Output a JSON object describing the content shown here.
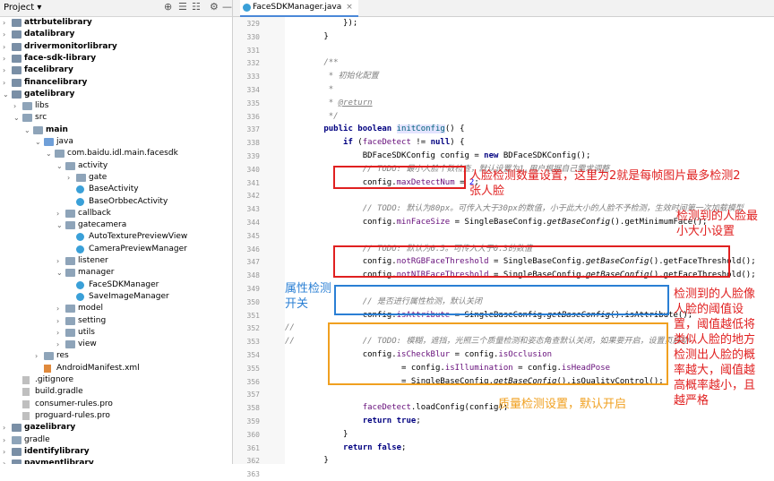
{
  "project": {
    "title": "Project",
    "title_arrow": "▾",
    "toolbar": [
      "⊕",
      "☰",
      "☷",
      "⚙",
      "—"
    ],
    "tree": [
      {
        "arrow": "›",
        "icon": "mod",
        "label": "attrbutelibrary",
        "bold": true,
        "indent": 0
      },
      {
        "arrow": "›",
        "icon": "mod",
        "label": "datalibrary",
        "bold": true,
        "indent": 0
      },
      {
        "arrow": "›",
        "icon": "mod",
        "label": "drivermonitorlibrary",
        "bold": true,
        "indent": 0
      },
      {
        "arrow": "›",
        "icon": "mod",
        "label": "face-sdk-library",
        "bold": true,
        "indent": 0
      },
      {
        "arrow": "›",
        "icon": "mod",
        "label": "facelibrary",
        "bold": true,
        "indent": 0
      },
      {
        "arrow": "›",
        "icon": "mod",
        "label": "financelibrary",
        "bold": true,
        "indent": 0
      },
      {
        "arrow": "⌄",
        "icon": "mod",
        "label": "gatelibrary",
        "bold": true,
        "indent": 0
      },
      {
        "arrow": "›",
        "icon": "folder",
        "label": "libs",
        "bold": false,
        "indent": 1
      },
      {
        "arrow": "⌄",
        "icon": "folder",
        "label": "src",
        "bold": false,
        "indent": 1
      },
      {
        "arrow": "⌄",
        "icon": "folder",
        "label": "main",
        "bold": true,
        "indent": 2
      },
      {
        "arrow": "⌄",
        "icon": "src",
        "label": "java",
        "bold": false,
        "indent": 3
      },
      {
        "arrow": "⌄",
        "icon": "folder",
        "label": "com.baidu.idl.main.facesdk",
        "bold": false,
        "indent": 4
      },
      {
        "arrow": "⌄",
        "icon": "folder",
        "label": "activity",
        "bold": false,
        "indent": 5
      },
      {
        "arrow": "›",
        "icon": "folder",
        "label": "gate",
        "bold": false,
        "indent": 6
      },
      {
        "arrow": "",
        "icon": "cls",
        "label": "BaseActivity",
        "bold": false,
        "indent": 6
      },
      {
        "arrow": "",
        "icon": "cls",
        "label": "BaseOrbbecActivity",
        "bold": false,
        "indent": 6
      },
      {
        "arrow": "›",
        "icon": "folder",
        "label": "callback",
        "bold": false,
        "indent": 5
      },
      {
        "arrow": "⌄",
        "icon": "folder",
        "label": "gatecamera",
        "bold": false,
        "indent": 5
      },
      {
        "arrow": "",
        "icon": "cls",
        "label": "AutoTexturePreviewView",
        "bold": false,
        "indent": 6
      },
      {
        "arrow": "",
        "icon": "cls",
        "label": "CameraPreviewManager",
        "bold": false,
        "indent": 6
      },
      {
        "arrow": "›",
        "icon": "folder",
        "label": "listener",
        "bold": false,
        "indent": 5
      },
      {
        "arrow": "⌄",
        "icon": "folder",
        "label": "manager",
        "bold": false,
        "indent": 5
      },
      {
        "arrow": "",
        "icon": "cls",
        "label": "FaceSDKManager",
        "bold": false,
        "indent": 6
      },
      {
        "arrow": "",
        "icon": "cls",
        "label": "SaveImageManager",
        "bold": false,
        "indent": 6
      },
      {
        "arrow": "›",
        "icon": "folder",
        "label": "model",
        "bold": false,
        "indent": 5
      },
      {
        "arrow": "›",
        "icon": "folder",
        "label": "setting",
        "bold": false,
        "indent": 5
      },
      {
        "arrow": "›",
        "icon": "folder",
        "label": "utils",
        "bold": false,
        "indent": 5
      },
      {
        "arrow": "›",
        "icon": "folder",
        "label": "view",
        "bold": false,
        "indent": 5
      },
      {
        "arrow": "›",
        "icon": "folder",
        "label": "res",
        "bold": false,
        "indent": 3
      },
      {
        "arrow": "",
        "icon": "xml",
        "label": "AndroidManifest.xml",
        "bold": false,
        "indent": 3
      },
      {
        "arrow": "",
        "icon": "file",
        "label": ".gitignore",
        "bold": false,
        "indent": 1
      },
      {
        "arrow": "",
        "icon": "file",
        "label": "build.gradle",
        "bold": false,
        "indent": 1
      },
      {
        "arrow": "",
        "icon": "file",
        "label": "consumer-rules.pro",
        "bold": false,
        "indent": 1
      },
      {
        "arrow": "",
        "icon": "file",
        "label": "proguard-rules.pro",
        "bold": false,
        "indent": 1
      },
      {
        "arrow": "›",
        "icon": "mod",
        "label": "gazelibrary",
        "bold": true,
        "indent": 0
      },
      {
        "arrow": "›",
        "icon": "folder",
        "label": "gradle",
        "bold": false,
        "indent": 0
      },
      {
        "arrow": "›",
        "icon": "mod",
        "label": "identifylibrary",
        "bold": true,
        "indent": 0
      },
      {
        "arrow": "›",
        "icon": "mod",
        "label": "paymentlibrary",
        "bold": true,
        "indent": 0
      }
    ]
  },
  "editor": {
    "tab_label": "FaceSDKManager.java",
    "tab_close": "×",
    "lines": [
      {
        "n": "329",
        "c": [
          [
            "",
            "            });"
          ]
        ]
      },
      {
        "n": "330",
        "c": [
          [
            "",
            "        }"
          ]
        ]
      },
      {
        "n": "331",
        "c": [
          [
            "",
            ""
          ]
        ]
      },
      {
        "n": "332",
        "c": [
          [
            "cm",
            "        /**"
          ]
        ]
      },
      {
        "n": "333",
        "c": [
          [
            "cm",
            "         * 初始化配置"
          ]
        ]
      },
      {
        "n": "334",
        "c": [
          [
            "cm",
            "         *"
          ]
        ]
      },
      {
        "n": "335",
        "c": [
          [
            "cm",
            "         * "
          ],
          [
            "tag",
            "@return"
          ]
        ]
      },
      {
        "n": "336",
        "c": [
          [
            "cm",
            "         */"
          ]
        ]
      },
      {
        "n": "337",
        "c": [
          [
            "kw",
            "        public boolean "
          ],
          [
            "fn",
            "initConfig"
          ],
          [
            "",
            "() {"
          ]
        ]
      },
      {
        "n": "338",
        "c": [
          [
            "kw",
            "            if "
          ],
          [
            "",
            "("
          ],
          [
            "fld",
            "faceDetect"
          ],
          [
            "",
            " != "
          ],
          [
            "kw",
            "null"
          ],
          [
            "",
            ") {"
          ]
        ]
      },
      {
        "n": "339",
        "c": [
          [
            "",
            "                BDFaceSDKConfig config = "
          ],
          [
            "kw",
            "new "
          ],
          [
            "",
            "BDFaceSDKConfig();"
          ]
        ]
      },
      {
        "n": "340",
        "c": [
          [
            "cm",
            "                // TODO: 最小人脸个数检查，默认设置为1,用户根据自己需求调整"
          ]
        ]
      },
      {
        "n": "341",
        "c": [
          [
            "",
            "                config."
          ],
          [
            "fld",
            "maxDetectNum"
          ],
          [
            "",
            " = "
          ],
          [
            "num",
            "2"
          ],
          [
            "",
            ";"
          ]
        ]
      },
      {
        "n": "342",
        "c": [
          [
            "",
            ""
          ]
        ]
      },
      {
        "n": "343",
        "c": [
          [
            "cm",
            "                // TODO: 默认为80px。可传入大于30px的数值，小于此大小的人脸不予检测，生效时间第一次加载模型"
          ]
        ]
      },
      {
        "n": "344",
        "c": [
          [
            "",
            "                config."
          ],
          [
            "fld",
            "minFaceSize"
          ],
          [
            "",
            " = SingleBaseConfig."
          ],
          [
            "mi",
            "getBaseConfig"
          ],
          [
            "",
            "().getMinimumFace();"
          ]
        ]
      },
      {
        "n": "345",
        "c": [
          [
            "",
            ""
          ]
        ]
      },
      {
        "n": "346",
        "c": [
          [
            "cm",
            "                // TODO: 默认为0.5。可传入大于0.3的数值"
          ]
        ]
      },
      {
        "n": "347",
        "c": [
          [
            "",
            "                config."
          ],
          [
            "fld",
            "notRGBFaceThreshold"
          ],
          [
            "",
            " = SingleBaseConfig."
          ],
          [
            "mi",
            "getBaseConfig"
          ],
          [
            "",
            "().getFaceThreshold();"
          ]
        ]
      },
      {
        "n": "348",
        "c": [
          [
            "",
            "                config."
          ],
          [
            "fld",
            "notNIRFaceThreshold"
          ],
          [
            "",
            " = SingleBaseConfig."
          ],
          [
            "mi",
            "getBaseConfig"
          ],
          [
            "",
            "().getFaceThreshold();"
          ]
        ]
      },
      {
        "n": "349",
        "c": [
          [
            "",
            ""
          ]
        ]
      },
      {
        "n": "350",
        "c": [
          [
            "cm",
            "                // 是否进行属性检测，默认关闭"
          ]
        ]
      },
      {
        "n": "351",
        "c": [
          [
            "",
            "                config."
          ],
          [
            "fld",
            "isAttribute"
          ],
          [
            "",
            " = SingleBaseConfig."
          ],
          [
            "mi",
            "getBaseConfig"
          ],
          [
            "",
            "().isAttribute();"
          ]
        ]
      },
      {
        "n": "352",
        "c": [
          [
            "cm",
            "//"
          ]
        ]
      },
      {
        "n": "353",
        "c": [
          [
            "cm",
            "//              // TODO: 模糊，遮挡，光照三个质量检测和姿态角查默认关闭，如果要开启，设置页启动"
          ]
        ]
      },
      {
        "n": "354",
        "c": [
          [
            "",
            "                config."
          ],
          [
            "fld",
            "isCheckBlur"
          ],
          [
            "",
            " = config."
          ],
          [
            "fld",
            "isOcclusion"
          ]
        ]
      },
      {
        "n": "355",
        "c": [
          [
            "",
            "                        = config."
          ],
          [
            "fld",
            "isIllumination"
          ],
          [
            "",
            " = config."
          ],
          [
            "fld",
            "isHeadPose"
          ]
        ]
      },
      {
        "n": "356",
        "c": [
          [
            "",
            "                        = SingleBaseConfig."
          ],
          [
            "mi",
            "getBaseConfig"
          ],
          [
            "",
            "().isQualityControl();"
          ]
        ]
      },
      {
        "n": "357",
        "c": [
          [
            "",
            ""
          ]
        ]
      },
      {
        "n": "358",
        "c": [
          [
            "",
            "                "
          ],
          [
            "fld",
            "faceDetect"
          ],
          [
            "",
            ".loadConfig(config);"
          ]
        ]
      },
      {
        "n": "359",
        "c": [
          [
            "kw",
            "                return true"
          ],
          [
            "",
            ";"
          ]
        ]
      },
      {
        "n": "360",
        "c": [
          [
            "",
            "            }"
          ]
        ]
      },
      {
        "n": "361",
        "c": [
          [
            "kw",
            "            return false"
          ],
          [
            "",
            ";"
          ]
        ]
      },
      {
        "n": "362",
        "c": [
          [
            "",
            "        }"
          ]
        ]
      },
      {
        "n": "363",
        "c": [
          [
            "",
            ""
          ]
        ]
      }
    ]
  },
  "annotations": {
    "max_detect": "人脸检测数量设置，这里为2就是每帧图片最多检测2\n张人脸",
    "min_face": "检测到的人脸最\n小大小设置",
    "attribute": "属性检测\n开关",
    "threshold": "检测到的人脸像\n人脸的阈值设\n置，阈值越低将\n类似人脸的地方\n检测出人脸的概\n率越大，阈值越\n高概率越小，且\n越严格",
    "quality": "质量检测设置，默认开启"
  },
  "colors": {
    "red": "#e02020",
    "blue": "#2a7fd4",
    "orange": "#f0a020"
  }
}
